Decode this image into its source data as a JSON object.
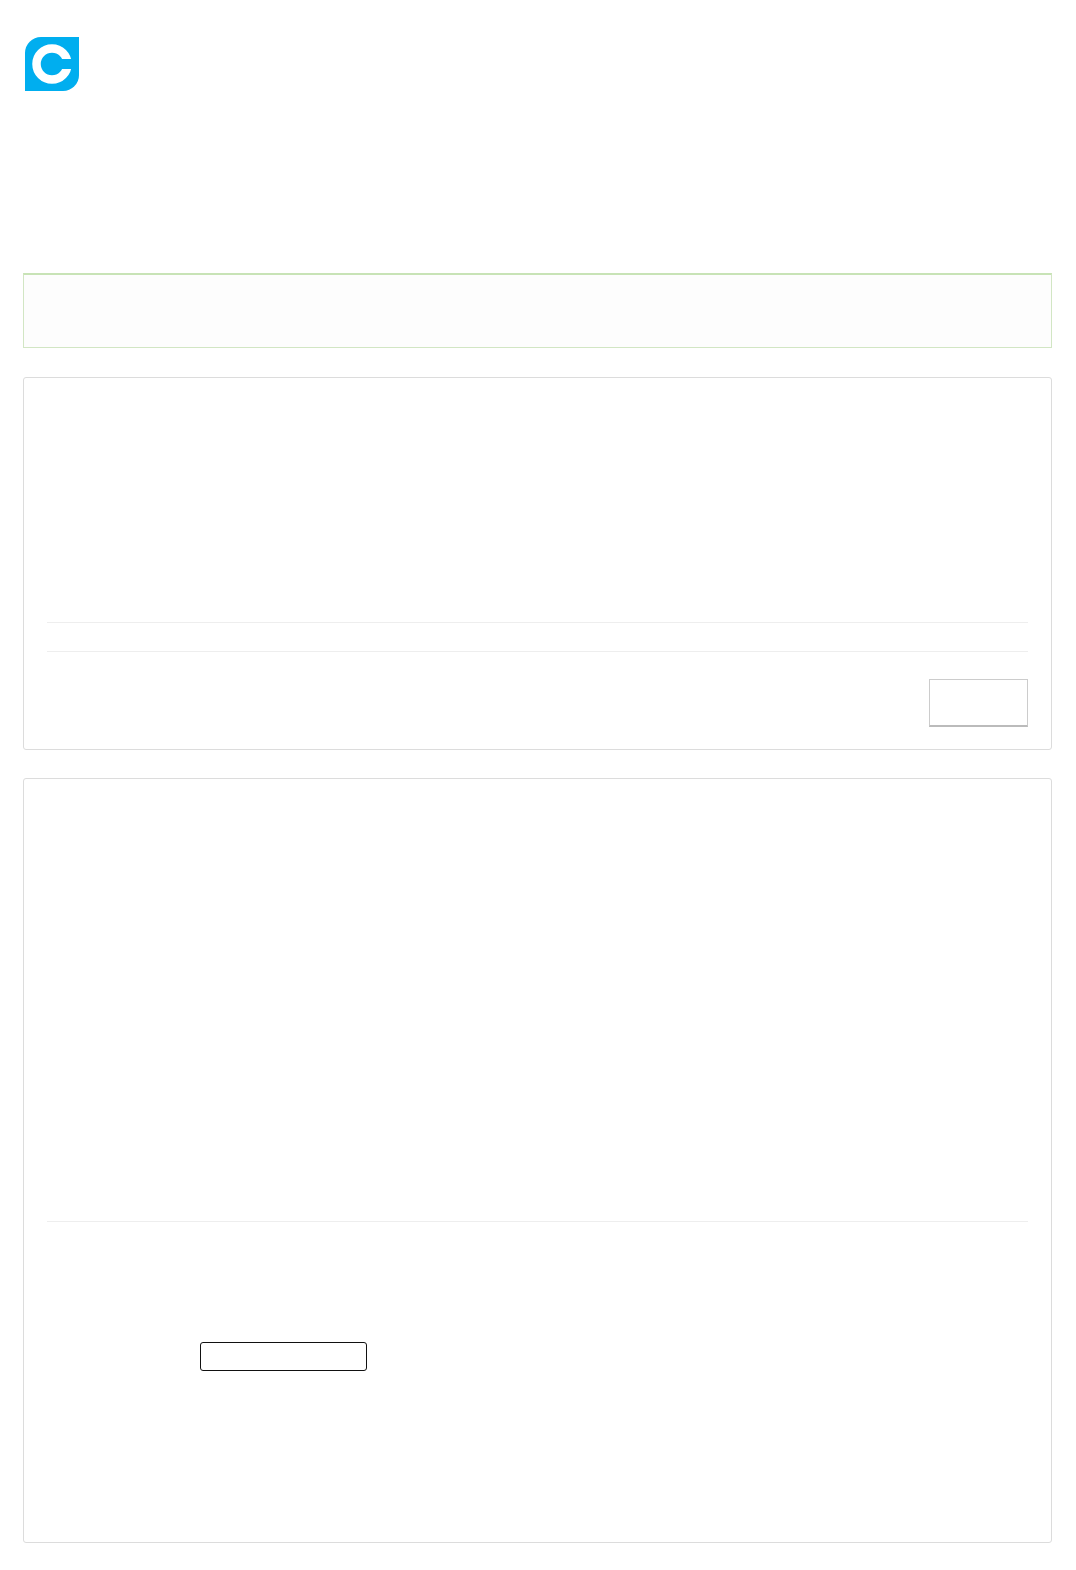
{
  "panels": [
    {
      "kind": "notice"
    },
    {
      "kind": "actions-card"
    },
    {
      "kind": "field-card"
    }
  ]
}
